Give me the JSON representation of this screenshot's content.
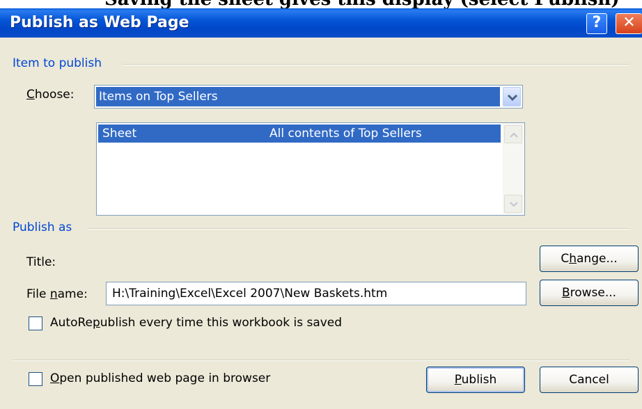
{
  "top_strip_text": "Saving the sheet gives this display (select Publish)",
  "dialog": {
    "title": "Publish as Web Page",
    "help_label": "?",
    "close_label": "✕"
  },
  "item_to_publish": {
    "group_label": "Item to publish",
    "choose_label_underlined": "C",
    "choose_label_rest": "hoose:",
    "choose_value": "Items on Top Sellers",
    "list_rows": [
      {
        "type": "Sheet",
        "description": "All contents of Top Sellers"
      }
    ]
  },
  "publish_as": {
    "group_label": "Publish as",
    "title_label": "Title:",
    "change_button_pre": "C",
    "change_button_underlined": "h",
    "change_button_post": "ange...",
    "file_name_label_pre": "File ",
    "file_name_label_underlined": "n",
    "file_name_label_post": "ame:",
    "file_name_value": "H:\\Training\\Excel\\Excel 2007\\New Baskets.htm",
    "browse_button_underlined": "B",
    "browse_button_post": "rowse...",
    "autorepublish_pre": "AutoRe",
    "autorepublish_underlined": "p",
    "autorepublish_post": "ublish every time this workbook is saved",
    "autorepublish_checked": false
  },
  "footer": {
    "open_in_browser_underlined": "O",
    "open_in_browser_post": "pen published web page in browser",
    "open_in_browser_checked": false,
    "publish_button_underlined": "P",
    "publish_button_post": "ublish",
    "cancel_button": "Cancel"
  },
  "colors": {
    "titlebar": "#0054e3",
    "selection": "#316ac5",
    "group_label": "#0046d5",
    "dialog_bg": "#ece9d8"
  }
}
